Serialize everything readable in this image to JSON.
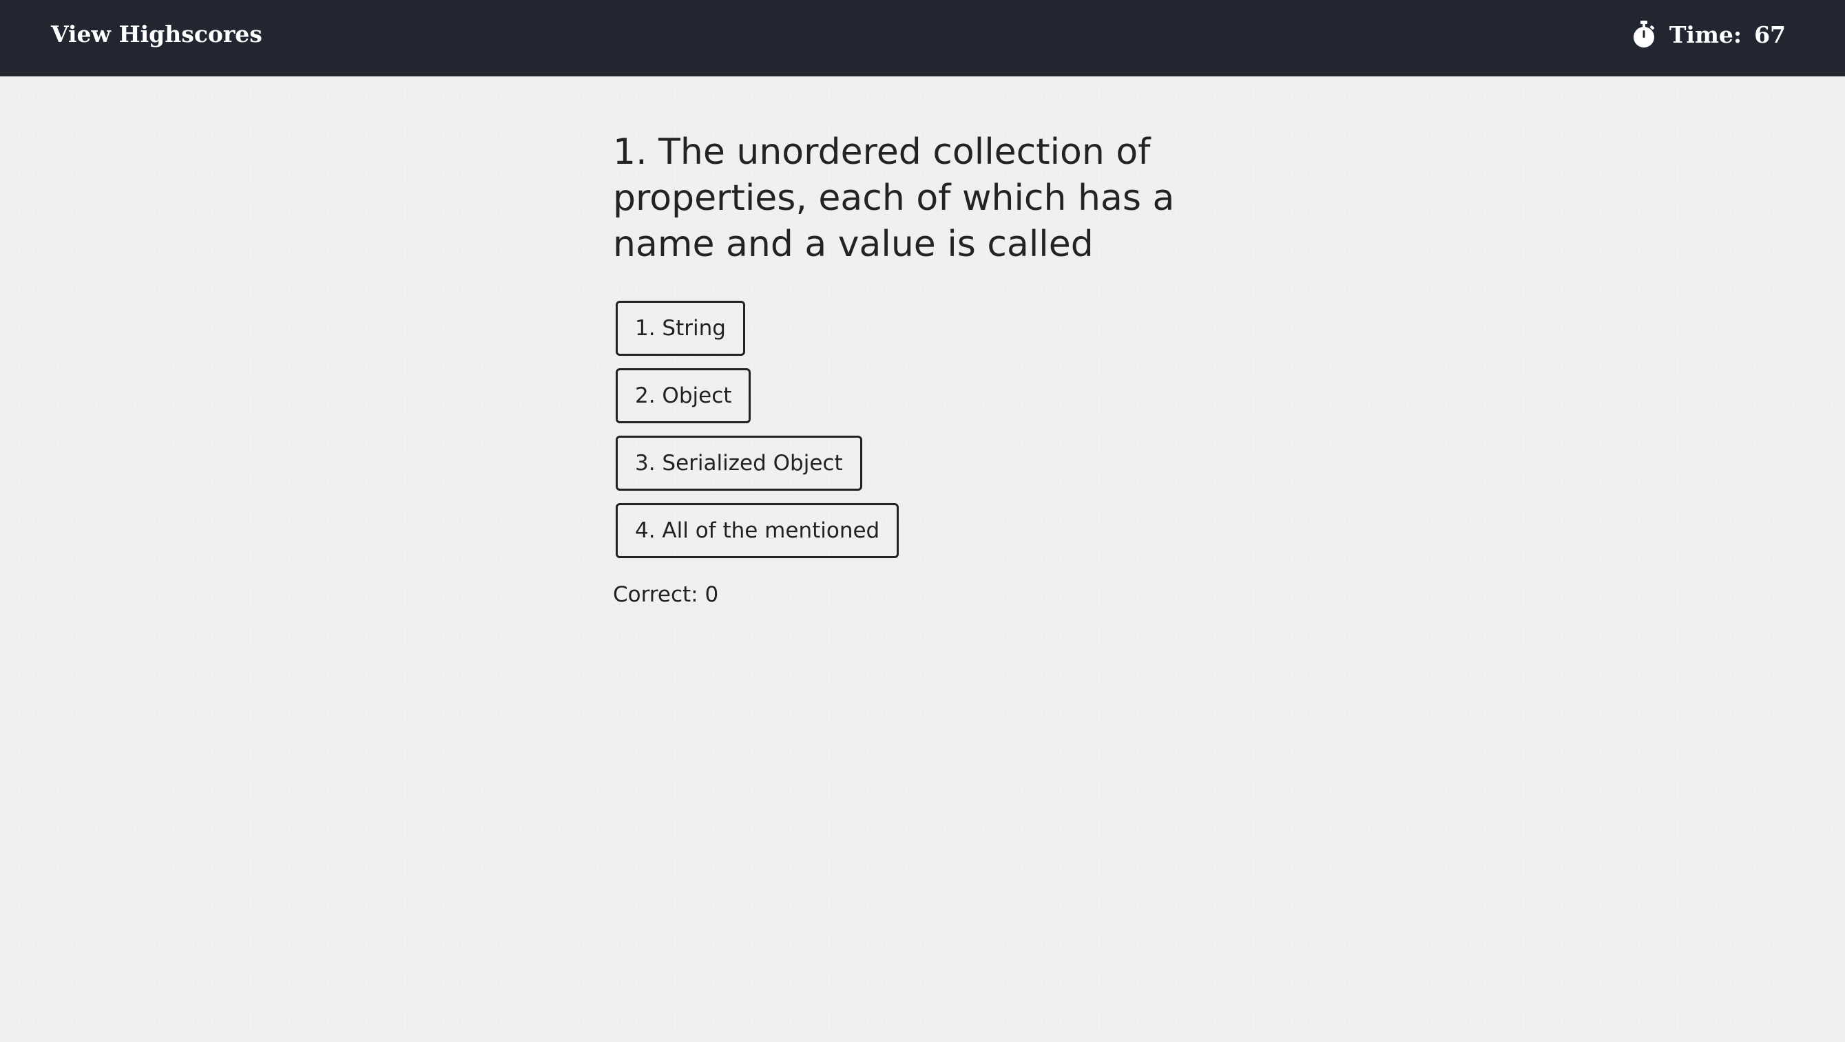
{
  "header": {
    "highscores_label": "View Highscores",
    "timer_icon": "stopwatch-icon",
    "time_label": "Time:",
    "time_value": "67"
  },
  "quiz": {
    "question": "1. The unordered collection of properties, each of which has a name and a value is called",
    "choices": [
      "1. String",
      "2. Object",
      "3. Serialized Object",
      "4. All of the mentioned"
    ],
    "result_label": "Correct:",
    "result_value": "0"
  },
  "colors": {
    "navbar_bg": "#212631",
    "page_bg": "#f0f0f0",
    "text": "#222222"
  }
}
